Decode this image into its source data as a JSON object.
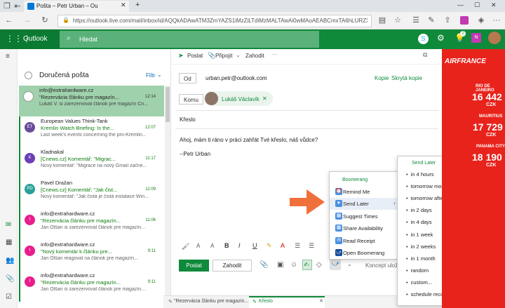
{
  "browser": {
    "tab_title": "Pošta – Petr Urban – Ou",
    "url": "https://outlook.live.com/mail/inbox/id/AQQkADAwATM3ZmYAZS1iMzZiLTdiMzMALTAwAi0wMAoAEABCmxTA6hLURZXV%2Fm813BI"
  },
  "outlook": {
    "brand": "Outlook",
    "search_placeholder": "Hledat",
    "badge_count": "2"
  },
  "toolbar": {
    "send": "Poslat",
    "attach": "Připojit",
    "discard": "Zahodit",
    "more": "···"
  },
  "inbox": {
    "title": "Doručená pošta",
    "filter": "Filtr"
  },
  "messages": [
    {
      "initials": "",
      "color": "#e91e8c",
      "from": "info@extrahardware.cz",
      "subject": "\"Rezervácia článku pre magazín...",
      "time": "12:14",
      "preview": "Lukáš V. si zarezervoval článok pre magazín Cn..."
    },
    {
      "initials": "ET",
      "color": "#6b4c9a",
      "from": "European Values Think-Tank",
      "subject": "Kremlin Watch Briefing: Is the...",
      "time": "12:07",
      "preview": "Last week's events concerning the pro-Kremlin..."
    },
    {
      "initials": "K",
      "color": "#6b3fb5",
      "from": "Kladnakal",
      "subject": "[Cnews.cz] Komentář: \"Migrac...",
      "time": "11:17",
      "preview": "Nový komentář: \"Migrace na nový Gmail začne..."
    },
    {
      "initials": "PD",
      "color": "#2aa198",
      "from": "Pavel Dražan",
      "subject": "[Cnews.cz] Komentář: \"Jak čist...",
      "time": "11:09",
      "preview": "Nový komentář: \"Jak čistá je čistá instalace Win..."
    },
    {
      "initials": "I",
      "color": "#e91e8c",
      "from": "info@extrahardware.cz",
      "subject": "\"Rezervácia článku pre magazín...",
      "time": "11:06",
      "preview": "Jan Olšan si zarezervoval článok pre magazín..."
    },
    {
      "initials": "I",
      "color": "#e91e8c",
      "from": "info@extrahardware.cz",
      "subject": "\"Nový komentár k článku pre...",
      "time": "9:11",
      "preview": "Jan Olšan reagoval na článok pre magazín..."
    },
    {
      "initials": "I",
      "color": "#e91e8c",
      "from": "info@extrahardware.cz",
      "subject": "\"Rezervácia článku pre magazín...",
      "time": "9:11",
      "preview": "Jan Olšan si zarezervoval článok pre magazín..."
    }
  ],
  "compose": {
    "from_label": "Od",
    "from_value": "urban.petr@outlook.com",
    "copy": "Kopie",
    "bcc": "Skrytá kopie",
    "to_label": "Komu",
    "to_value": "Lukáš Václavík",
    "subject": "Křeslo",
    "body_line1": "Ahoj, mám ti ráno v práci zahřát Tvé křeslo, náš vůdce?",
    "body_line2": "--Petr Urban",
    "send": "Poslat",
    "discard": "Zahodit",
    "draft": "Koncept ulož"
  },
  "boomerang_menu": {
    "title": "Boomerang",
    "items": [
      "Remind Me",
      "Send Later",
      "Suggest Times",
      "Share Availability",
      "Read Receipt",
      "Open Boomerang"
    ]
  },
  "send_later": {
    "title": "Send Later",
    "items": [
      "in 4 hours",
      "tomorrow morning",
      "tomorrow afternoon",
      "in 2 days",
      "in 4 days",
      "in 1 week",
      "in 2 weeks",
      "in 1 month",
      "random",
      "custom...",
      "schedule recurring message"
    ]
  },
  "bottom_tabs": {
    "tab1": "\"Rezervácia článku pre magazín...",
    "tab2": "Křeslo"
  },
  "ad": {
    "brand": "AIRFRANCE",
    "dest1": "RIO DE JANEIRO",
    "price1": "16 442",
    "dest2": "MAURITIUS",
    "price2": "17 729",
    "dest3": "PANAMA CITY",
    "price3": "18 190",
    "currency": "CZK"
  },
  "colors": {
    "outlook_green": "#0f893a",
    "ad_red": "#e8231c",
    "arrow_orange": "#f0703c"
  }
}
